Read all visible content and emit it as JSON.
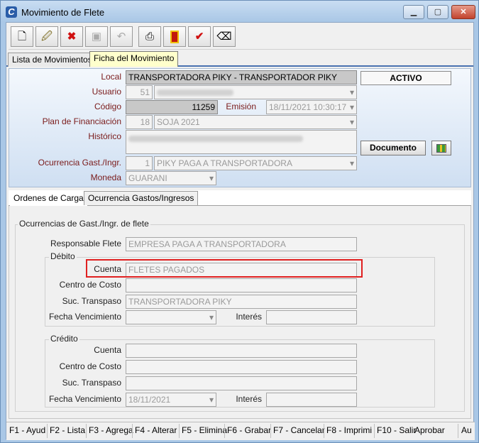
{
  "window": {
    "title": "Movimiento de Flete",
    "min_icon": "minimize-icon",
    "max_icon": "maximize-icon",
    "close_icon": "close-icon"
  },
  "toolbar": [
    {
      "name": "new-button",
      "icon": "new-document-icon",
      "glyph": "🗋"
    },
    {
      "name": "edit-button",
      "icon": "edit-document-icon",
      "glyph": "🖉"
    },
    {
      "name": "delete-button",
      "icon": "delete-document-icon",
      "glyph": "✖"
    },
    {
      "name": "save-button",
      "icon": "save-icon",
      "glyph": "💾"
    },
    {
      "name": "undo-button",
      "icon": "undo-icon",
      "glyph": "↶"
    },
    {
      "name": "print-button",
      "icon": "printer-icon",
      "glyph": "🖶"
    },
    {
      "name": "exit-button",
      "icon": "exit-door-icon",
      "glyph": "🚪"
    },
    {
      "name": "approve-button",
      "icon": "checkmark-icon",
      "glyph": "✔"
    },
    {
      "name": "clear-button",
      "icon": "eraser-icon",
      "glyph": "⌫"
    }
  ],
  "tabs_top": [
    {
      "label": "Lista de Movimientos",
      "active": false
    },
    {
      "label": "Ficha del Movimiento",
      "active": true
    }
  ],
  "header": {
    "local_label": "Local",
    "local_value": "TRANSPORTADORA PIKY - TRANSPORTADOR PIKY",
    "status": "ACTIVO",
    "usuario_label": "Usuario",
    "usuario_code": "51",
    "codigo_label": "Código",
    "codigo_value": "11259",
    "emision_label": "Emisión",
    "emision_value": "18/11/2021 10:30:17",
    "plan_label": "Plan de Financiación",
    "plan_code": "18",
    "plan_value": "SOJA 2021",
    "historico_label": "Histórico",
    "documento_button": "Documento",
    "documento_icon": "document-grid-icon",
    "ocurrencia_label": "Ocurrencia Gast./Ingr.",
    "ocurrencia_code": "1",
    "ocurrencia_value": "PIKY PAGA A TRANSPORTADORA",
    "moneda_label": "Moneda",
    "moneda_value": "GUARANI"
  },
  "tabs_mid": [
    {
      "label": "Ordenes de Carga",
      "active": false
    },
    {
      "label": "Ocurrencia Gastos/Ingresos",
      "active": true
    }
  ],
  "panel": {
    "group_title": "Ocurrencias de Gast./Ingr. de flete",
    "responsable_label": "Responsable Flete",
    "responsable_value": "EMPRESA PAGA A TRANSPORTADORA",
    "debito": {
      "title": "Débito",
      "cuenta_label": "Cuenta",
      "cuenta_value": "FLETES PAGADOS",
      "centro_label": "Centro de Costo",
      "centro_value": "",
      "suc_label": "Suc. Transpaso",
      "suc_value": "TRANSPORTADORA PIKY",
      "fecha_label": "Fecha Vencimiento",
      "fecha_value": "",
      "interes_label": "Interés",
      "interes_value": ""
    },
    "credito": {
      "title": "Crédito",
      "cuenta_label": "Cuenta",
      "cuenta_value": "",
      "centro_label": "Centro de Costo",
      "centro_value": "",
      "suc_label": "Suc. Transpaso",
      "suc_value": "",
      "fecha_label": "Fecha Vencimiento",
      "fecha_value": "18/11/2021",
      "interes_label": "Interés",
      "interes_value": ""
    }
  },
  "fkeys": [
    "F1 - Ayud",
    "F2 - Lista",
    "F3 - Agrega",
    "F4 - Alterar",
    "F5 - Elimina",
    "F6 - Grabar",
    "F7 - Cancelar",
    "F8 - Imprimi",
    "F10 - Salir",
    "Aprobar",
    "Au"
  ],
  "colors": {
    "highlight": "#e02020",
    "label_red": "#7a1a1a",
    "active_tab": "#ffffcc"
  }
}
